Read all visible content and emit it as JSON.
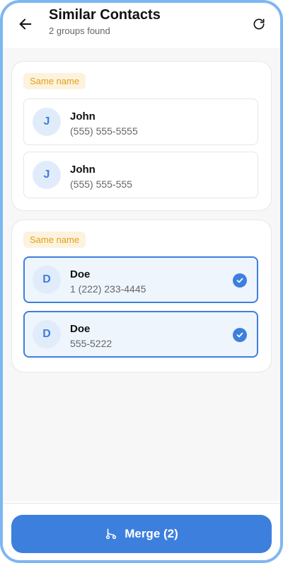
{
  "header": {
    "title": "Similar Contacts",
    "subtitle": "2 groups found",
    "back_icon": "arrow-left-icon",
    "refresh_icon": "refresh-icon"
  },
  "groups": [
    {
      "badge": "Same name",
      "contacts": [
        {
          "initial": "J",
          "name": "John",
          "phone": "(555) 555-5555",
          "selected": false
        },
        {
          "initial": "J",
          "name": "John",
          "phone": "(555) 555-555",
          "selected": false
        }
      ]
    },
    {
      "badge": "Same name",
      "contacts": [
        {
          "initial": "D",
          "name": "Doe",
          "phone": "1 (222) 233-4445",
          "selected": true
        },
        {
          "initial": "D",
          "name": "Doe",
          "phone": "555-5222",
          "selected": true
        }
      ]
    }
  ],
  "footer": {
    "merge_label": "Merge (2)",
    "merge_icon": "merge-icon"
  },
  "colors": {
    "accent": "#3d7fdc",
    "badge_bg": "#fdf2dd",
    "badge_text": "#e0a11a",
    "frame": "#7fb6f2"
  }
}
